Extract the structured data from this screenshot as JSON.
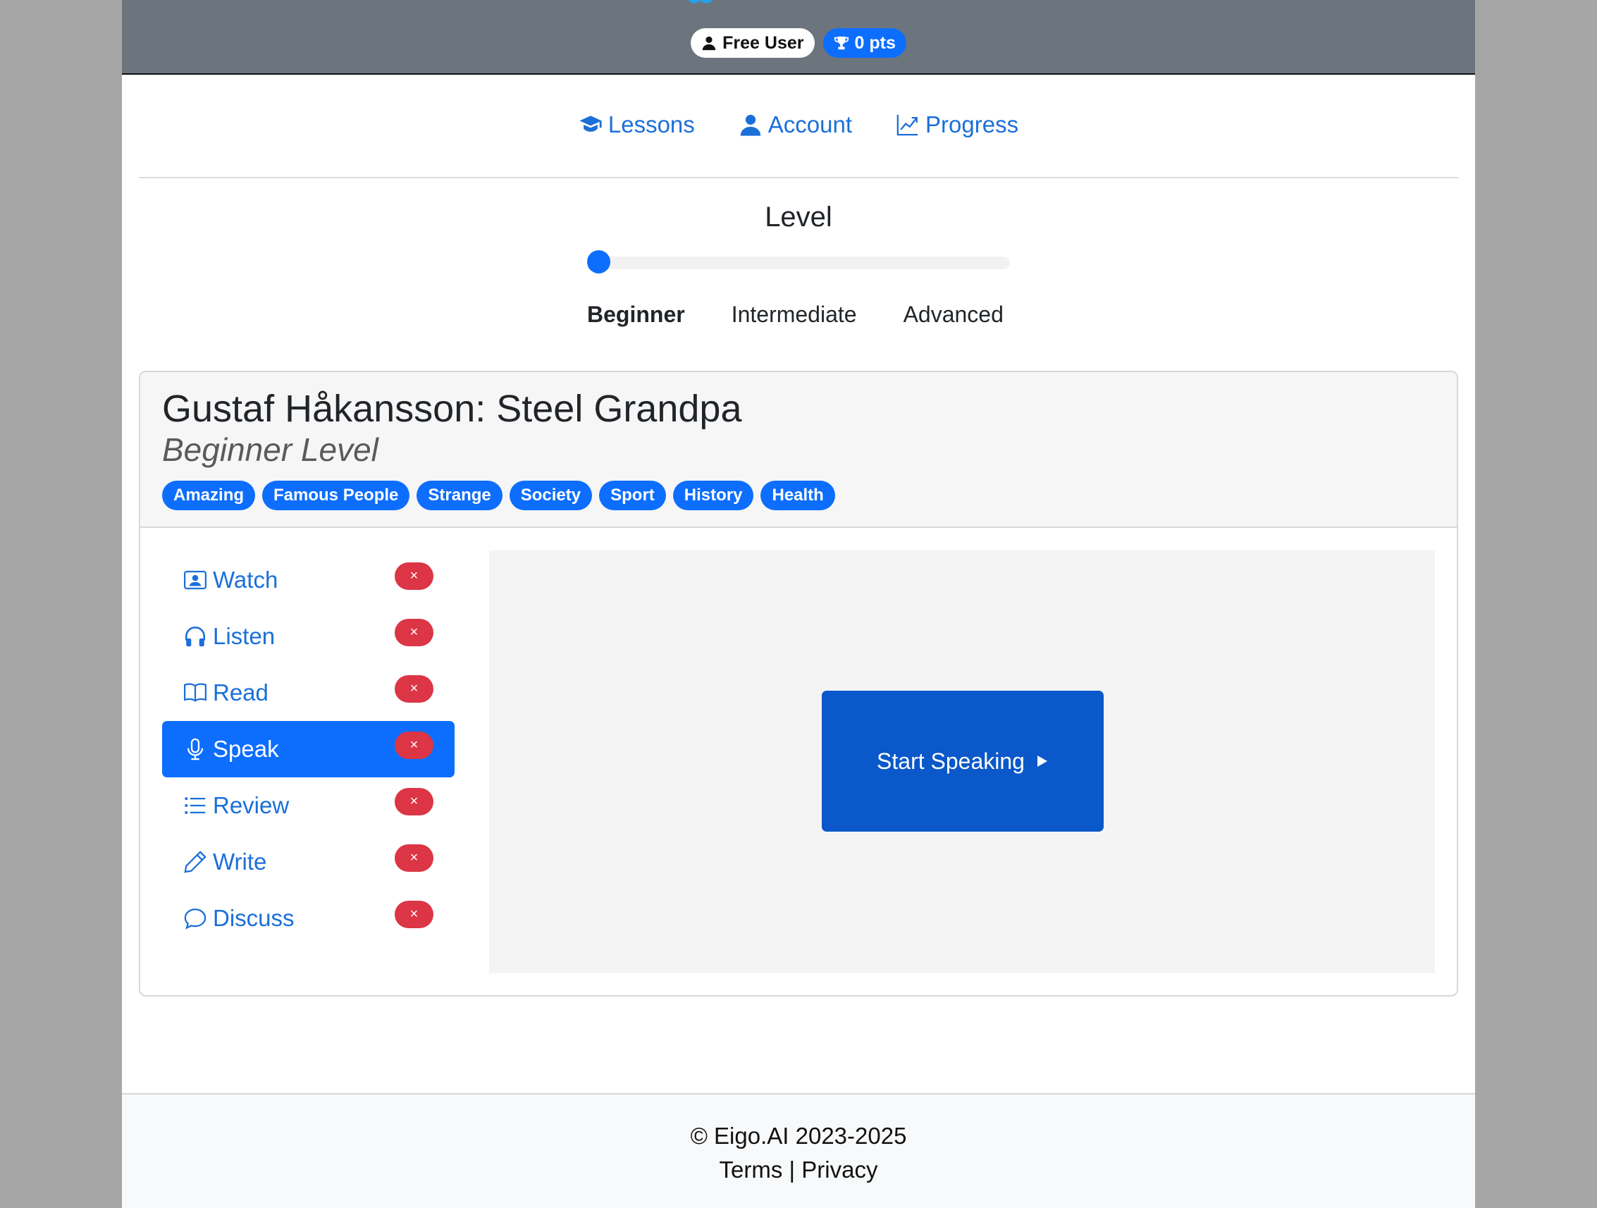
{
  "header": {
    "user_badge": "Free User",
    "points_badge": "0 pts",
    "icons": {
      "user": "user-icon",
      "points": "trophy-icon"
    }
  },
  "nav": {
    "items": [
      {
        "label": "Lessons",
        "icon": "graduation-cap-icon"
      },
      {
        "label": "Account",
        "icon": "user-icon"
      },
      {
        "label": "Progress",
        "icon": "chart-line-icon"
      }
    ]
  },
  "level": {
    "title": "Level",
    "options": [
      "Beginner",
      "Intermediate",
      "Advanced"
    ],
    "selected": "Beginner",
    "slider_value": 0
  },
  "lesson": {
    "title": "Gustaf Håkansson: Steel Grandpa",
    "subtitle": "Beginner Level",
    "tags": [
      "Amazing",
      "Famous People",
      "Strange",
      "Society",
      "Sport",
      "History",
      "Health"
    ]
  },
  "sidebar": {
    "items": [
      {
        "label": "Watch",
        "icon": "video-icon",
        "status": "×"
      },
      {
        "label": "Listen",
        "icon": "headphones-icon",
        "status": "×"
      },
      {
        "label": "Read",
        "icon": "book-icon",
        "status": "×"
      },
      {
        "label": "Speak",
        "icon": "microphone-icon",
        "status": "×",
        "active": true
      },
      {
        "label": "Review",
        "icon": "list-icon",
        "status": "×"
      },
      {
        "label": "Write",
        "icon": "pencil-icon",
        "status": "×"
      },
      {
        "label": "Discuss",
        "icon": "chat-icon",
        "status": "×"
      }
    ]
  },
  "main": {
    "start_button": "Start Speaking",
    "start_icon": "play-icon"
  },
  "footer": {
    "copyright": "© Eigo.AI 2023-2025",
    "terms": "Terms",
    "separator": "|",
    "privacy": "Privacy"
  },
  "colors": {
    "header_bg": "#6c757d",
    "primary": "#0d6efd",
    "link": "#1b6fd9",
    "danger": "#dc3545",
    "button_dark": "#0a58ca"
  }
}
